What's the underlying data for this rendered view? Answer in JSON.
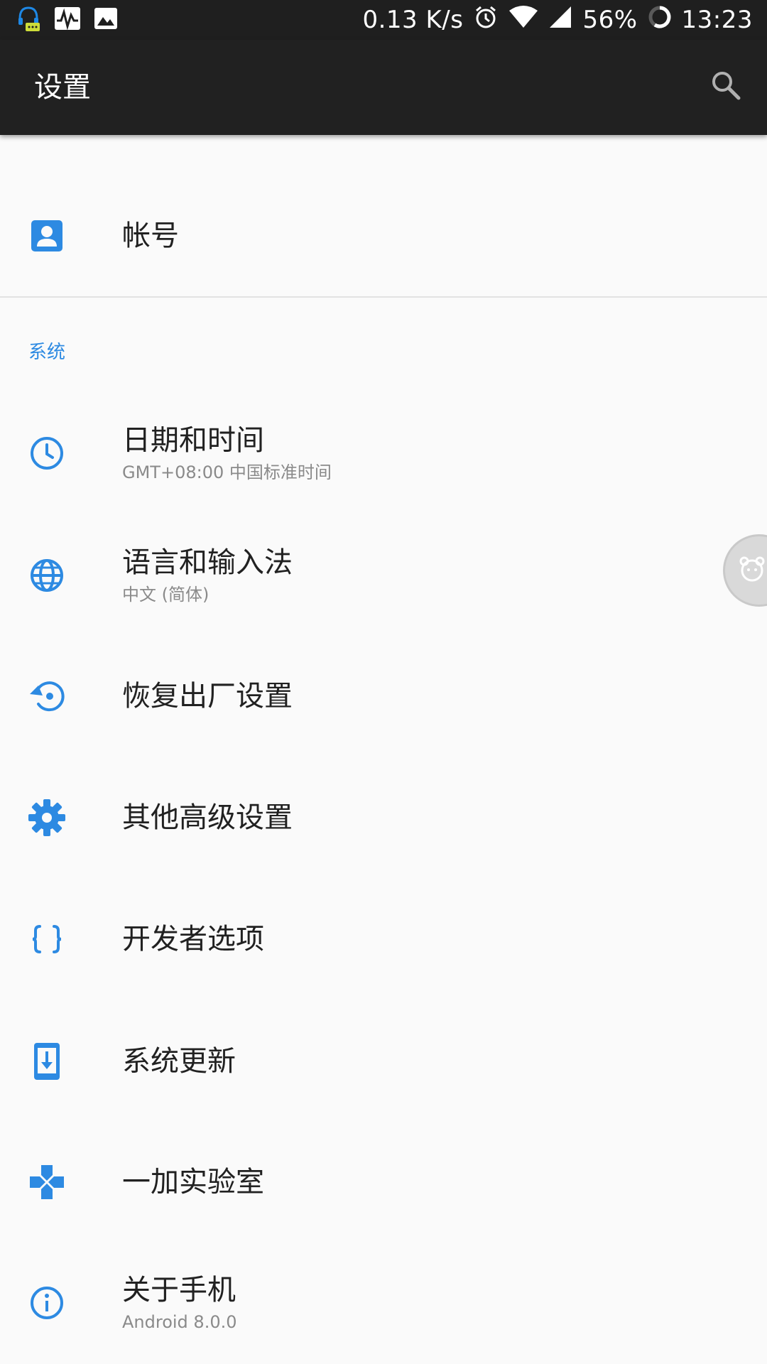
{
  "status_bar": {
    "net_speed": "0.13 K/s",
    "battery": "56%",
    "time": "13:23",
    "icons": [
      "headset-notification-icon",
      "activity-icon",
      "image-icon",
      "alarm-icon",
      "wifi-icon",
      "signal-icon",
      "battery-ring-icon"
    ]
  },
  "app_bar": {
    "title": "设置",
    "search_icon": "search-icon"
  },
  "accent_color": "#2d8ae2",
  "account": {
    "icon": "account-box-icon",
    "title": "帐号"
  },
  "section_system": {
    "header": "系统",
    "items": [
      {
        "icon": "clock-icon",
        "title": "日期和时间",
        "subtitle": "GMT+08:00 中国标准时间"
      },
      {
        "icon": "globe-icon",
        "title": "语言和输入法",
        "subtitle": "中文 (简体)"
      },
      {
        "icon": "restore-icon",
        "title": "恢复出厂设置"
      },
      {
        "icon": "gear-icon",
        "title": "其他高级设置"
      },
      {
        "icon": "code-braces-icon",
        "title": "开发者选项"
      },
      {
        "icon": "system-update-icon",
        "title": "系统更新"
      },
      {
        "icon": "gamepad-icon",
        "title": "一加实验室"
      },
      {
        "icon": "info-icon",
        "title": "关于手机",
        "subtitle": "Android 8.0.0"
      }
    ]
  }
}
